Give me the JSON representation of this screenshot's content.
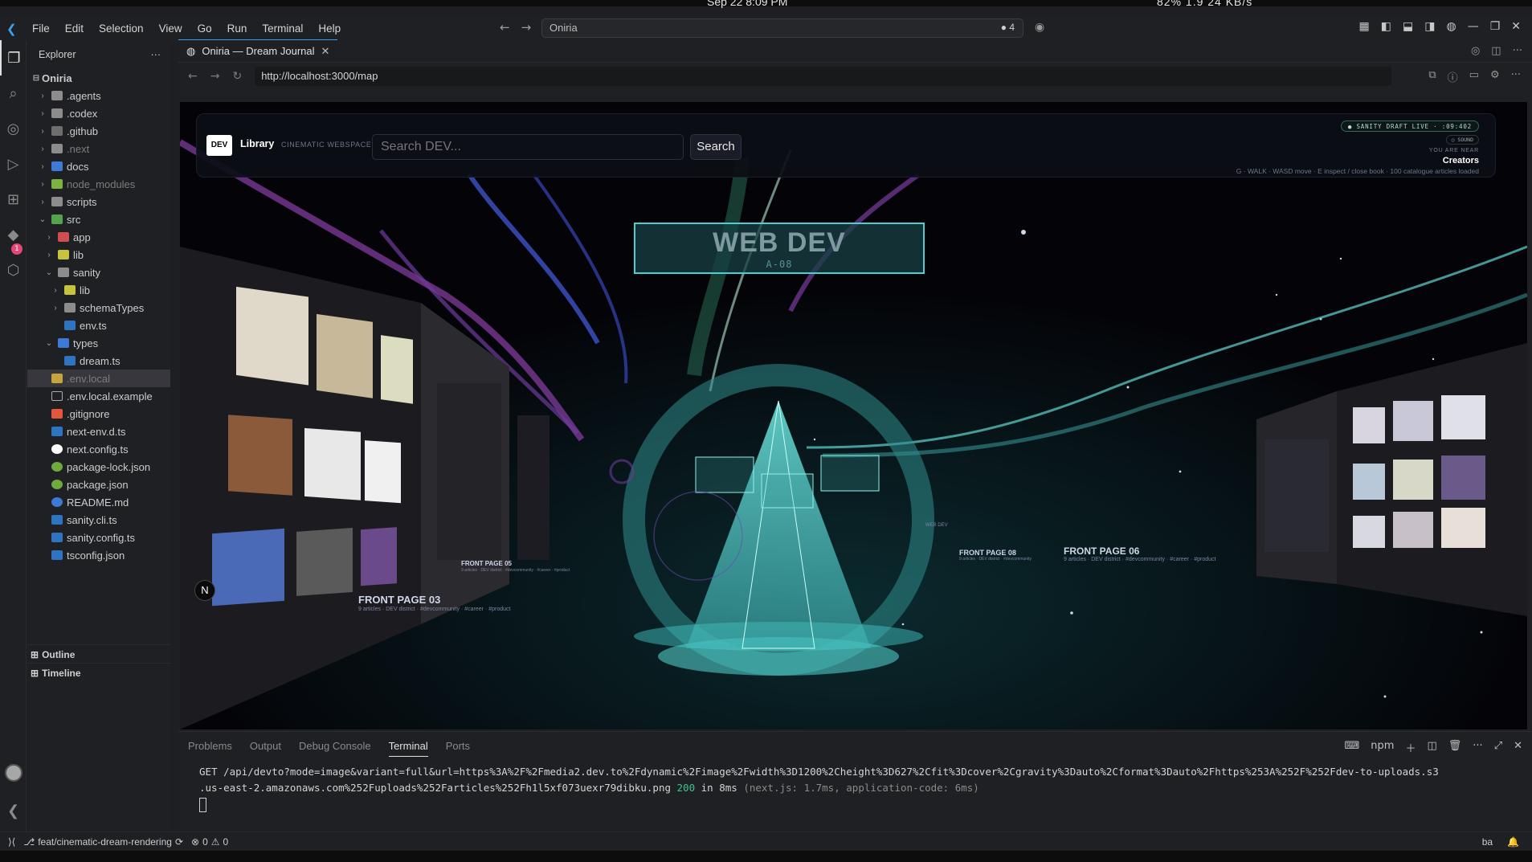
{
  "system": {
    "clock": "Sep 22  8:09 PM",
    "stats": "82%  1.9  24 KB/s"
  },
  "menu": [
    "File",
    "Edit",
    "Selection",
    "View",
    "Go",
    "Run",
    "Terminal",
    "Help"
  ],
  "command_center": {
    "text": "Oniria",
    "right": "● 4"
  },
  "explorer": {
    "title": "Explorer",
    "root": "Oniria",
    "items": [
      {
        "label": ".agents",
        "depth": 1,
        "chev": "›",
        "icon": "folder"
      },
      {
        "label": ".codex",
        "depth": 1,
        "chev": "›",
        "icon": "folder"
      },
      {
        "label": ".github",
        "depth": 1,
        "chev": "›",
        "icon": "gh"
      },
      {
        "label": ".next",
        "depth": 1,
        "chev": "›",
        "icon": "folder",
        "dim": true
      },
      {
        "label": "docs",
        "depth": 1,
        "chev": "›",
        "icon": "docs"
      },
      {
        "label": "node_modules",
        "depth": 1,
        "chev": "›",
        "icon": "nm",
        "dim": true
      },
      {
        "label": "scripts",
        "depth": 1,
        "chev": "›",
        "icon": "folder"
      },
      {
        "label": "src",
        "depth": 1,
        "chev": "⌄",
        "icon": "src"
      },
      {
        "label": "app",
        "depth": 2,
        "chev": "›",
        "icon": "app"
      },
      {
        "label": "lib",
        "depth": 2,
        "chev": "›",
        "icon": "lib"
      },
      {
        "label": "sanity",
        "depth": 2,
        "chev": "⌄",
        "icon": "folder"
      },
      {
        "label": "lib",
        "depth": 3,
        "chev": "›",
        "icon": "lib"
      },
      {
        "label": "schemaTypes",
        "depth": 3,
        "chev": "›",
        "icon": "folder"
      },
      {
        "label": "env.ts",
        "depth": 3,
        "chev": "",
        "icon": "ts"
      },
      {
        "label": "types",
        "depth": 2,
        "chev": "⌄",
        "icon": "types"
      },
      {
        "label": "dream.ts",
        "depth": 3,
        "chev": "",
        "icon": "ts"
      },
      {
        "label": ".env.local",
        "depth": 1,
        "chev": "",
        "icon": "env",
        "dim": true,
        "sel": true
      },
      {
        "label": ".env.local.example",
        "depth": 1,
        "chev": "",
        "icon": "file"
      },
      {
        "label": ".gitignore",
        "depth": 1,
        "chev": "",
        "icon": "git"
      },
      {
        "label": "next-env.d.ts",
        "depth": 1,
        "chev": "",
        "icon": "ts"
      },
      {
        "label": "next.config.ts",
        "depth": 1,
        "chev": "",
        "icon": "nxt"
      },
      {
        "label": "package-lock.json",
        "depth": 1,
        "chev": "",
        "icon": "pkg"
      },
      {
        "label": "package.json",
        "depth": 1,
        "chev": "",
        "icon": "pkg"
      },
      {
        "label": "README.md",
        "depth": 1,
        "chev": "",
        "icon": "info"
      },
      {
        "label": "sanity.cli.ts",
        "depth": 1,
        "chev": "",
        "icon": "ts"
      },
      {
        "label": "sanity.config.ts",
        "depth": 1,
        "chev": "",
        "icon": "ts"
      },
      {
        "label": "tsconfig.json",
        "depth": 1,
        "chev": "",
        "icon": "json"
      }
    ],
    "outline": "Outline",
    "timeline": "Timeline"
  },
  "editor": {
    "tab_title": "Oniria — Dream Journal",
    "url": "http://localhost:3000/map"
  },
  "webpage": {
    "logo": "DEV",
    "library": "Library",
    "tagline": "CINEMATIC WEBSPACE",
    "search_placeholder": "Search DEV...",
    "search_button": "Search",
    "live_pill": "● SANITY DRAFT LIVE · :09:402",
    "sound": "○ SOUND",
    "near_label": "YOU ARE NEAR",
    "near_value": "Creators",
    "controls": "G · WALK · WASD move · E inspect / close book · 100 catalogue articles loaded",
    "sign_title": "WEB DEV",
    "sign_code": "A-08",
    "front_pages": [
      {
        "title": "FRONT PAGE 03",
        "sub": "9 articles · DEV district · #devcommunity · #career · #product"
      },
      {
        "title": "FRONT PAGE 05",
        "sub": "9 articles · DEV district · #devcommunity · #career · #product"
      },
      {
        "title": "FRONT PAGE 08",
        "sub": "9 articles · DEV district · #devcommunity"
      },
      {
        "title": "FRONT PAGE 06",
        "sub": "9 articles · DEV district · #devcommunity · #career · #product"
      }
    ],
    "n_button": "N",
    "webdev_small": "WEB DEV"
  },
  "panel": {
    "tabs": [
      "Problems",
      "Output",
      "Debug Console",
      "Terminal",
      "Ports"
    ],
    "active_tab": "Terminal",
    "shell": "npm",
    "line1": "GET /api/devto?mode=image&variant=full&url=https%3A%2F%2Fmedia2.dev.to%2Fdynamic%2Fimage%2Fwidth%3D1200%2Cheight%3D627%2Cfit%3Dcover%2Cgravity%3Dauto%2Cformat%3Dauto%2Fhttps%253A%252F%252Fdev-to-uploads.s3",
    "line2_a": ".us-east-2.amazonaws.com%252Fuploads%252Farticles%252Fh1l5xf073uexr79dibku.png ",
    "line2_status": "200",
    "line2_b": " in 8ms ",
    "line2_c": "(next.js: 1.7ms, application-code: 6ms)"
  },
  "status": {
    "branch": "feat/cinematic-dream-rendering",
    "errors": "0",
    "warnings": "0",
    "right": "ba"
  }
}
